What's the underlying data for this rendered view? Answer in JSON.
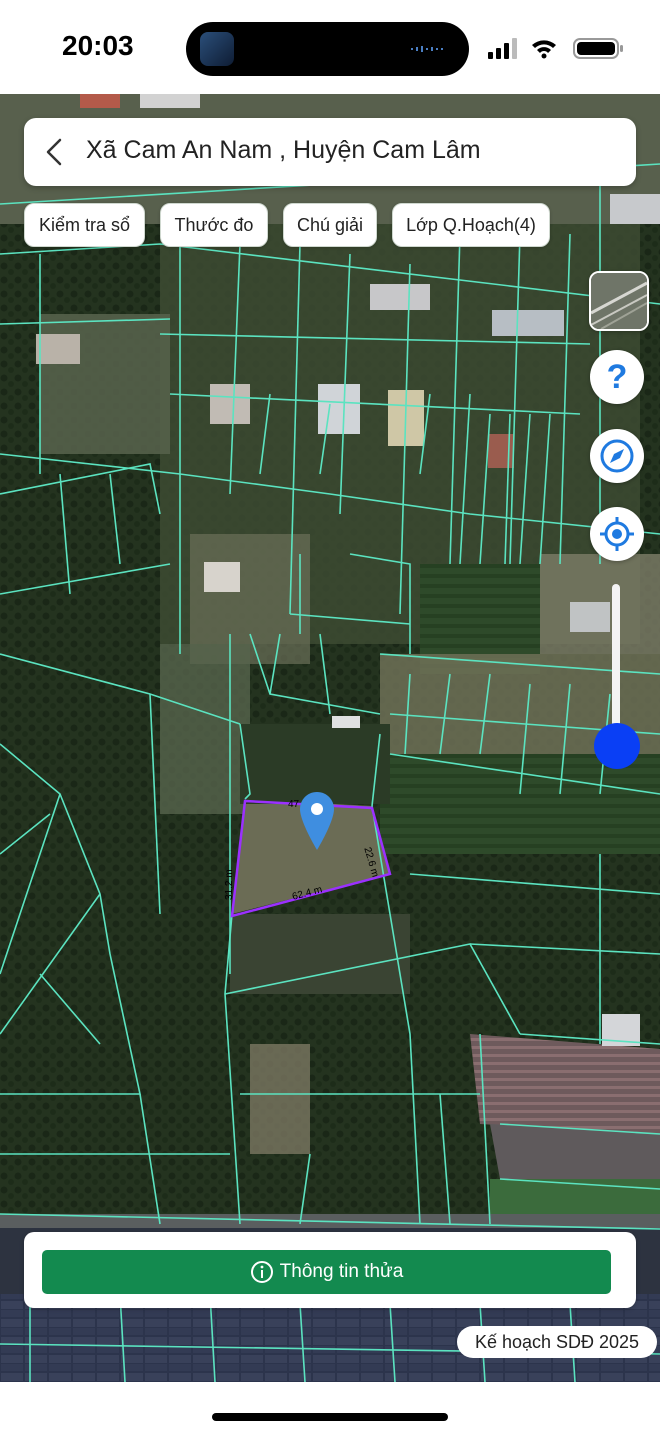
{
  "status_bar": {
    "time": "20:03"
  },
  "header": {
    "title": "Xã Cam An Nam , Huyện Cam Lâm"
  },
  "toolbar": {
    "chips": [
      {
        "label": "Kiểm tra sổ"
      },
      {
        "label": "Thước đo"
      },
      {
        "label": "Chú giải"
      },
      {
        "label": "Lớp Q.Hoạch(4)"
      }
    ]
  },
  "map": {
    "parcel_line_color": "#5be3c0",
    "selected_parcel_color": "#9b30ff",
    "dimensions": {
      "top": "47",
      "right": "22.6 m",
      "bottom": "62.4 m",
      "left": "31.2 m"
    },
    "zoom_fraction": 0.1
  },
  "icons": {
    "back": "chevron-left-icon",
    "layer": "satellite-layer-icon",
    "help": "help-icon",
    "compass": "compass-icon",
    "locate": "locate-icon",
    "pin": "map-pin-icon",
    "info": "info-icon"
  },
  "controls": {
    "help_glyph": "?"
  },
  "bottom": {
    "info_button_label": "Thông tin thửa",
    "plan_badge": "Kế hoạch SDĐ 2025"
  }
}
